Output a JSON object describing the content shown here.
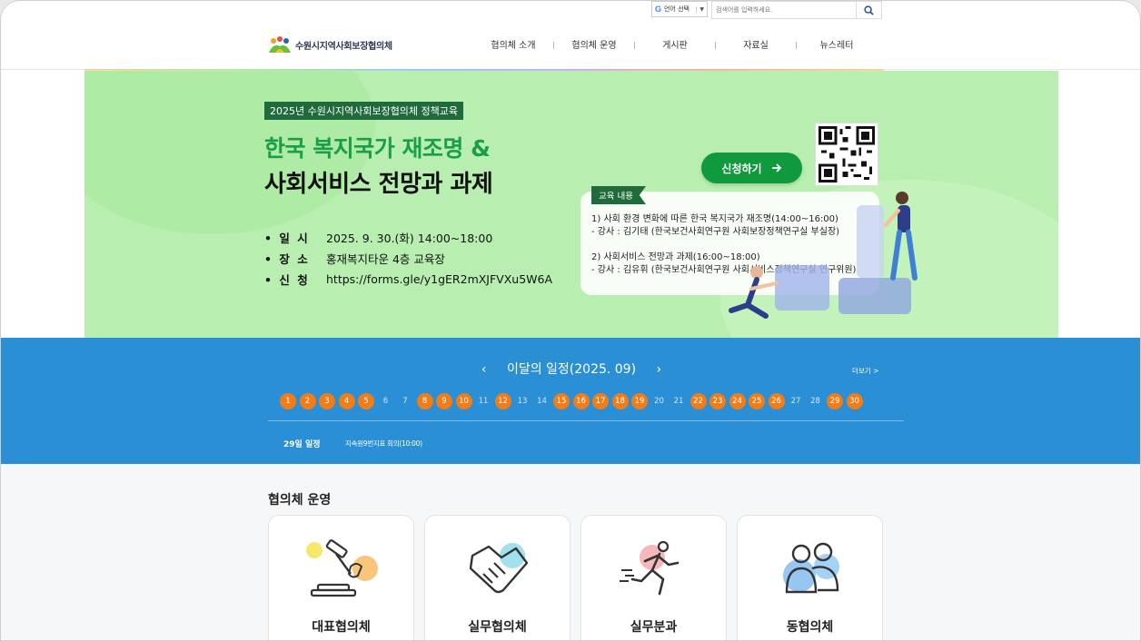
{
  "util": {
    "lang_label": "언어 선택",
    "search_placeholder": "검색어를 입력하세요."
  },
  "header": {
    "logo_text": "수원시지역사회보장협의체",
    "nav": [
      "협의체 소개",
      "협의체 운영",
      "게시판",
      "자료실",
      "뉴스레터"
    ]
  },
  "banner": {
    "tag": "2025년 수원시지역사회보장협의체 정책교육",
    "title_line1": "한국 복지국가 재조명 &",
    "title_line2": "사회서비스 전망과 과제",
    "info": [
      {
        "label": "• 일    시",
        "value": "2025. 9. 30.(화) 14:00~18:00"
      },
      {
        "label": "• 장    소",
        "value": "홍재복지타운 4층 교육장"
      },
      {
        "label": "• 신    청",
        "value": "https://forms.gle/y1gER2mXJFVXu5W6A"
      }
    ],
    "apply_label": "신청하기",
    "edu_tag": "교육 내용",
    "edu_lines": [
      "1) 사회 환경 변화에 따른 한국 복지국가 재조명(14:00~16:00)",
      "  - 강사 : 김기태 (한국보건사회연구원 사회보장정책연구실 부실장)",
      "",
      "2) 사회서비스 전망과 과제(16:00~18:00)",
      "  - 강사 : 김유휘 (한국보건사회연구원 사회서비스정책연구실 연구위원)"
    ]
  },
  "schedule": {
    "title": "이달의 일정(2025. 09)",
    "more": "더보기 >",
    "days": [
      {
        "d": "1",
        "on": true
      },
      {
        "d": "2",
        "on": true
      },
      {
        "d": "3",
        "on": true
      },
      {
        "d": "4",
        "on": true
      },
      {
        "d": "5",
        "on": true
      },
      {
        "d": "6",
        "on": false
      },
      {
        "d": "7",
        "on": false
      },
      {
        "d": "8",
        "on": true
      },
      {
        "d": "9",
        "on": true
      },
      {
        "d": "10",
        "on": true
      },
      {
        "d": "11",
        "on": false
      },
      {
        "d": "12",
        "on": true
      },
      {
        "d": "13",
        "on": false
      },
      {
        "d": "14",
        "on": false
      },
      {
        "d": "15",
        "on": true
      },
      {
        "d": "16",
        "on": true
      },
      {
        "d": "17",
        "on": true
      },
      {
        "d": "18",
        "on": true
      },
      {
        "d": "19",
        "on": true
      },
      {
        "d": "20",
        "on": false
      },
      {
        "d": "21",
        "on": false
      },
      {
        "d": "22",
        "on": true
      },
      {
        "d": "23",
        "on": true
      },
      {
        "d": "24",
        "on": true
      },
      {
        "d": "25",
        "on": true
      },
      {
        "d": "26",
        "on": true
      },
      {
        "d": "27",
        "on": false
      },
      {
        "d": "28",
        "on": false
      },
      {
        "d": "29",
        "on": true
      },
      {
        "d": "30",
        "on": true
      }
    ],
    "selected_label": "29일 일정",
    "selected_text": "지속원9번지표 회의(10:00)",
    "colors": {
      "bg": "#2b8fd6",
      "active_day": "#f07d18"
    }
  },
  "ops": {
    "title": "협의체 운영",
    "cards": [
      {
        "label": "대표협의체",
        "icon": "gavel-icon"
      },
      {
        "label": "실무협의체",
        "icon": "handshake-icon"
      },
      {
        "label": "실무분과",
        "icon": "running-person-icon"
      },
      {
        "label": "동협의체",
        "icon": "people-group-icon"
      }
    ]
  }
}
